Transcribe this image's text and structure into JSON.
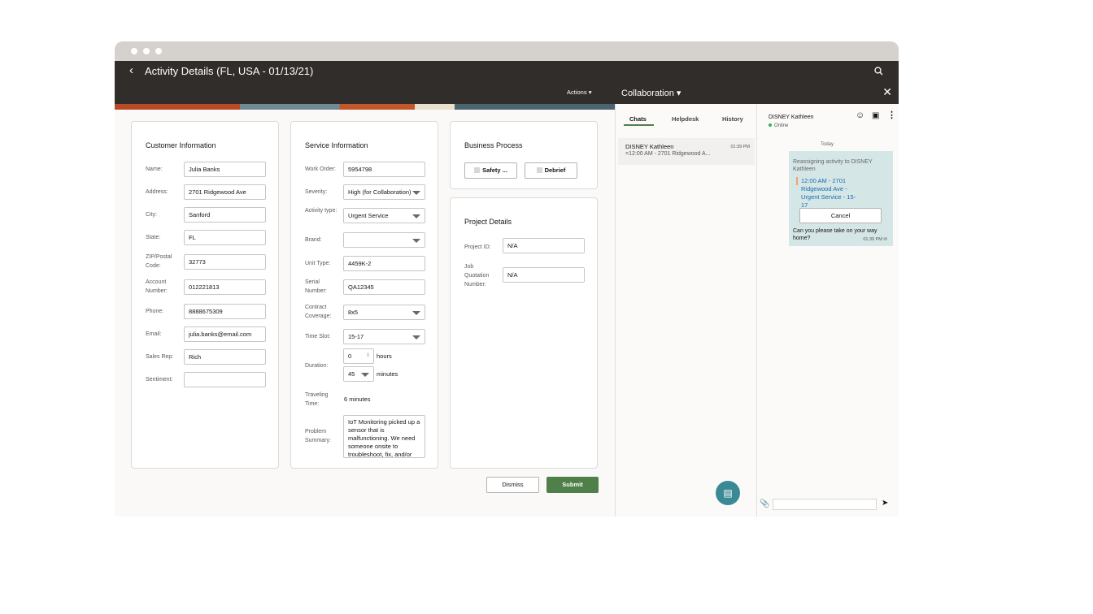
{
  "header": {
    "title": "Activity Details (FL, USA - 01/13/21)",
    "actions_label": "Actions"
  },
  "customer": {
    "title": "Customer Information",
    "fields": [
      {
        "label": "Name:",
        "value": "Julia Banks"
      },
      {
        "label": "Address:",
        "value": "2701 Ridgewood Ave"
      },
      {
        "label": "City:",
        "value": "Sanford"
      },
      {
        "label": "State:",
        "value": "FL"
      },
      {
        "label": "ZIP/Postal Code:",
        "value": "32773"
      },
      {
        "label": "Account Number:",
        "value": "012221813"
      },
      {
        "label": "Phone:",
        "value": "8888675309"
      },
      {
        "label": "Email:",
        "value": "julia.banks@email.com"
      },
      {
        "label": "Sales Rep:",
        "value": "Rich"
      },
      {
        "label": "Sentiment:",
        "value": ""
      }
    ]
  },
  "service": {
    "title": "Service Information",
    "fields": [
      {
        "label": "Work Order:",
        "value": "5954798"
      },
      {
        "label": "Severity:",
        "value": "High (for Collaboration)"
      },
      {
        "label": "Activity type:",
        "value": "Urgent Service"
      },
      {
        "label": "Brand:",
        "value": ""
      },
      {
        "label": "Unit Type:",
        "value": "4459K-2"
      },
      {
        "label": "Serial Number:",
        "value": "QA12345"
      },
      {
        "label": "Contract Coverage:",
        "value": "8x5"
      },
      {
        "label": "Time Slot:",
        "value": "15-17"
      }
    ],
    "duration_label": "Duration:",
    "hours_value": "0",
    "hours_unit": "hours",
    "minutes_value": "45",
    "minutes_unit": "minutes",
    "traveling_label": "Traveling Time:",
    "traveling_value": "6 minutes",
    "problem_label": "Problem Summary:",
    "problem_value": "IoT Monitoring picked up a sensor that is malfunctioning. We need someone onsite to troubleshoot, fix, and/or"
  },
  "business": {
    "title": "Business Process",
    "buttons": [
      "Safety ...",
      "Debrief"
    ]
  },
  "project": {
    "title": "Project Details",
    "fields": [
      {
        "label": "Project ID:",
        "value": "N/A"
      },
      {
        "label": "Job Quotation Number:",
        "value": "N/A"
      }
    ]
  },
  "footer": {
    "dismiss": "Dismiss",
    "submit": "Submit"
  },
  "collab": {
    "title": "Collaboration",
    "tabs": [
      "Chats",
      "Helpdesk",
      "History"
    ],
    "active_tab": "Chats",
    "chat_list": [
      {
        "name": "DISNEY Kathleen",
        "time": "01:39 PM",
        "preview": "=12:00 AM - 2701 Ridgewood A..."
      }
    ],
    "contact": {
      "name": "DISNEY Kathleen",
      "status": "Online"
    },
    "day": "Today",
    "message": {
      "text": "Reassigning activity to DISNEY Kathleen",
      "link": "12:00 AM - 2701 Ridgewood Ave - Urgent Service - 15-17",
      "button": "Cancel",
      "text2": "Can you please take on your way home?",
      "time": "01:39 PM"
    },
    "input_value": ""
  },
  "colors": {
    "header": "#312d2a",
    "submit": "#508049",
    "online": "#2fb35a",
    "bubble": "#d5e6e6",
    "fab": "#3a8a96",
    "link": "#1b6ab1"
  }
}
